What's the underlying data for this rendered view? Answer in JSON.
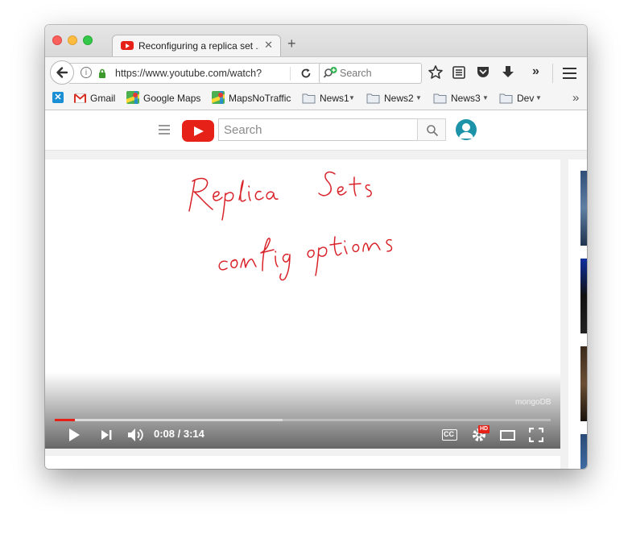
{
  "browser": {
    "tab_title": "Reconfiguring a replica set ...",
    "url": "https://www.youtube.com/watch?",
    "search_placeholder": "Search"
  },
  "bookmarks": [
    {
      "label": "Gmail"
    },
    {
      "label": "Google Maps"
    },
    {
      "label": "MapsNoTraffic"
    },
    {
      "label": "News1"
    },
    {
      "label": "News2"
    },
    {
      "label": "News3"
    },
    {
      "label": "Dev"
    }
  ],
  "youtube": {
    "search_placeholder": "Search"
  },
  "video": {
    "handwritten_line1": "Replica Sets",
    "handwritten_line2": "config options",
    "watermark": "mongoDB",
    "time_display": "0:08 / 3:14",
    "progress_played": 0.04,
    "progress_loaded": 0.46,
    "hd_badge": "HD",
    "cc_label": "CC"
  },
  "colors": {
    "youtube_red": "#e62117",
    "handwriting_red": "#d9232a",
    "avatar_teal": "#1c93a8"
  }
}
